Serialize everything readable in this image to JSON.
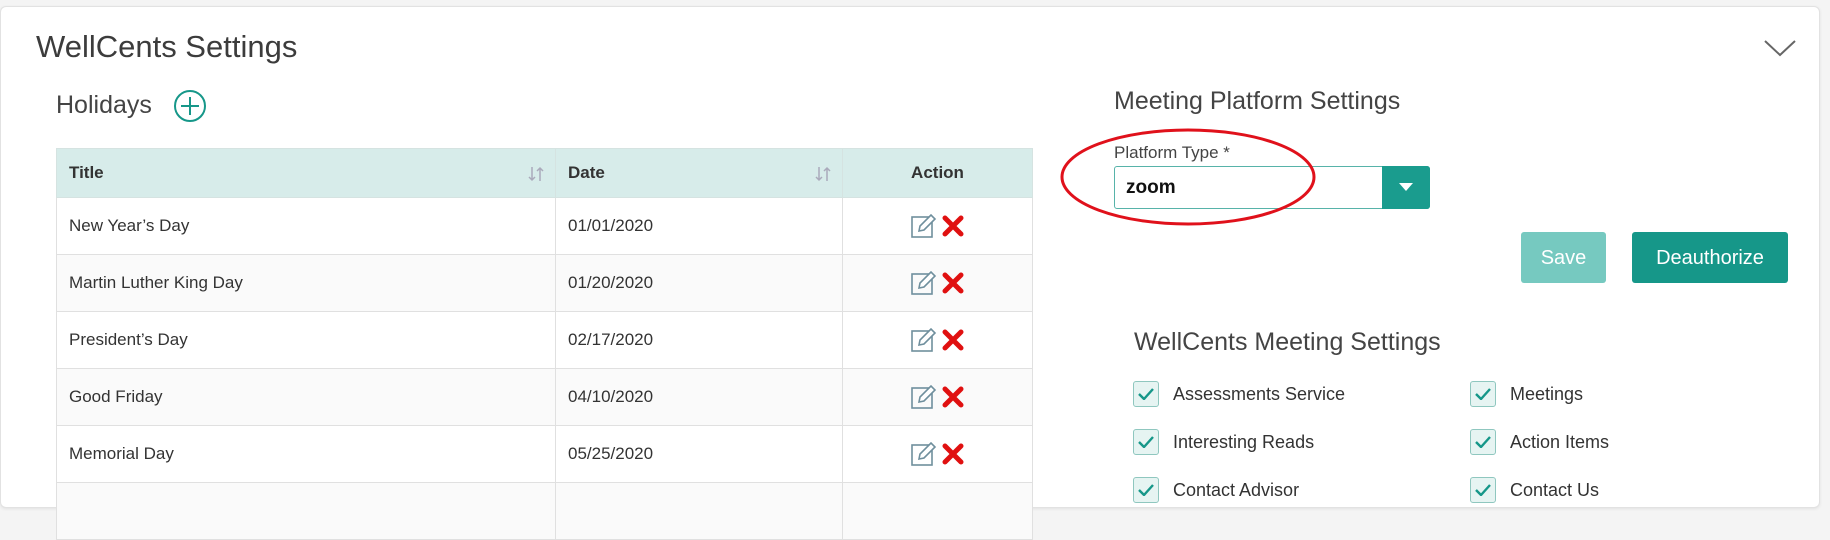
{
  "panel": {
    "title": "WellCents Settings"
  },
  "holidays": {
    "title": "Holidays",
    "columns": {
      "title": "Title",
      "date": "Date",
      "action": "Action"
    },
    "rows": [
      {
        "title": "New Year’s Day",
        "date": "01/01/2020"
      },
      {
        "title": "Martin Luther King Day",
        "date": "01/20/2020"
      },
      {
        "title": "President’s Day",
        "date": "02/17/2020"
      },
      {
        "title": "Good Friday",
        "date": "04/10/2020"
      },
      {
        "title": "Memorial Day",
        "date": "05/25/2020"
      }
    ]
  },
  "platform": {
    "title": "Meeting Platform Settings",
    "field_label": "Platform Type *",
    "selected": "zoom",
    "save_label": "Save",
    "deauthorize_label": "Deauthorize"
  },
  "meeting_settings": {
    "title": "WellCents Meeting Settings",
    "items": [
      {
        "label": "Assessments Service",
        "checked": true
      },
      {
        "label": "Meetings",
        "checked": true
      },
      {
        "label": "Interesting Reads",
        "checked": true
      },
      {
        "label": "Action Items",
        "checked": true
      },
      {
        "label": "Contact Advisor",
        "checked": true
      },
      {
        "label": "Contact Us",
        "checked": true
      }
    ]
  },
  "colors": {
    "accent": "#169789",
    "accent_light": "#76c9c0",
    "table_header": "#d7ecea",
    "delete": "#e01010",
    "highlight": "#e0111b"
  },
  "icons": {
    "add": "plus-circle-icon",
    "collapse": "chevron-down-icon",
    "sort": "sort-icon",
    "edit": "edit-icon",
    "delete": "delete-icon",
    "dropdown": "caret-down-icon",
    "check": "check-icon"
  }
}
